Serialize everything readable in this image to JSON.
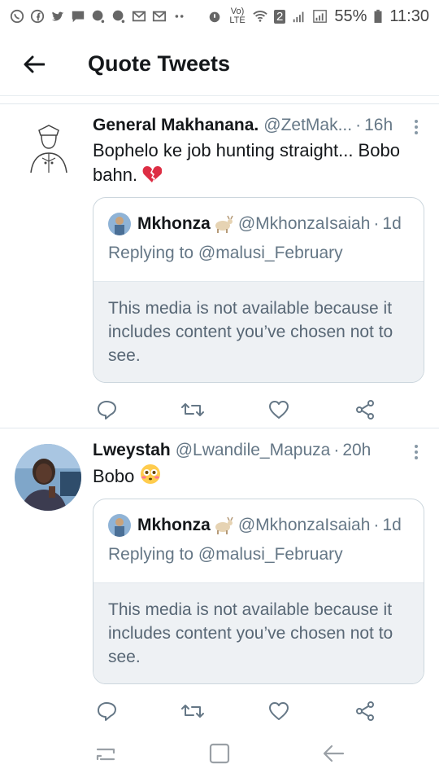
{
  "status_bar": {
    "battery": "55%",
    "time": "11:30",
    "sim_badge": "2",
    "volte": "Vo) LTE"
  },
  "header": {
    "title": "Quote Tweets"
  },
  "tweets": [
    {
      "author_name": "General Makhanana.",
      "handle": "@ZetMak...",
      "separator": "·",
      "time": "16h",
      "text": "Bophelo ke job hunting straight... Bobo bahn.",
      "quote": {
        "author_name": "Mkhonza",
        "handle": "@MkhonzaIsaiah",
        "separator": "·",
        "time": "1d",
        "reply_prefix": "Replying to",
        "reply_to": "@malusi_February",
        "media_notice": "This media is not available because it includes content you’ve chosen not to see."
      }
    },
    {
      "author_name": "Lweystah",
      "handle": "@Lwandile_Mapuza",
      "separator": "·",
      "time": "20h",
      "text": "Bobo",
      "quote": {
        "author_name": "Mkhonza",
        "handle": "@MkhonzaIsaiah",
        "separator": "·",
        "time": "1d",
        "reply_prefix": "Replying to",
        "reply_to": "@malusi_February",
        "media_notice": "This media is not available because it includes content you’ve chosen not to see."
      }
    }
  ],
  "icons": {
    "action_color": "#657786",
    "accent": "#1da1f2"
  }
}
